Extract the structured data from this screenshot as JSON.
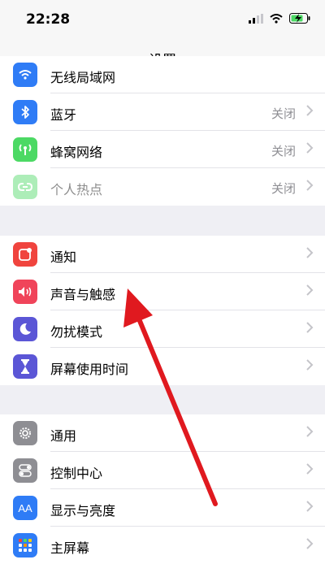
{
  "status": {
    "time": "22:28"
  },
  "nav": {
    "title": "设置"
  },
  "group1": [
    {
      "label": "无线局域网",
      "value": "",
      "color": "#2f7cf6",
      "icon": "wifi-icon"
    },
    {
      "label": "蓝牙",
      "value": "关闭",
      "color": "#2f7cf6",
      "icon": "bluetooth-icon"
    },
    {
      "label": "蜂窝网络",
      "value": "关闭",
      "color": "#4cd964",
      "icon": "cellular-antenna-icon"
    },
    {
      "label": "个人热点",
      "value": "关闭",
      "color": "#4cd964",
      "icon": "hotspot-link-icon"
    }
  ],
  "group2": [
    {
      "label": "通知",
      "color": "#f0443e",
      "icon": "notification-icon"
    },
    {
      "label": "声音与触感",
      "color": "#f0445a",
      "icon": "speaker-icon"
    },
    {
      "label": "勿扰模式",
      "color": "#5b56d6",
      "icon": "moon-icon"
    },
    {
      "label": "屏幕使用时间",
      "color": "#5b56d6",
      "icon": "hourglass-icon"
    }
  ],
  "group3": [
    {
      "label": "通用",
      "color": "#8e8e93",
      "icon": "gear-icon"
    },
    {
      "label": "控制中心",
      "color": "#8e8e93",
      "icon": "toggles-icon"
    },
    {
      "label": "显示与亮度",
      "color": "#2f7cf6",
      "icon": "text-size-icon",
      "glyph": "AA"
    },
    {
      "label": "主屏幕",
      "color": "#2f7cf6",
      "icon": "home-screen-grid-icon"
    }
  ]
}
